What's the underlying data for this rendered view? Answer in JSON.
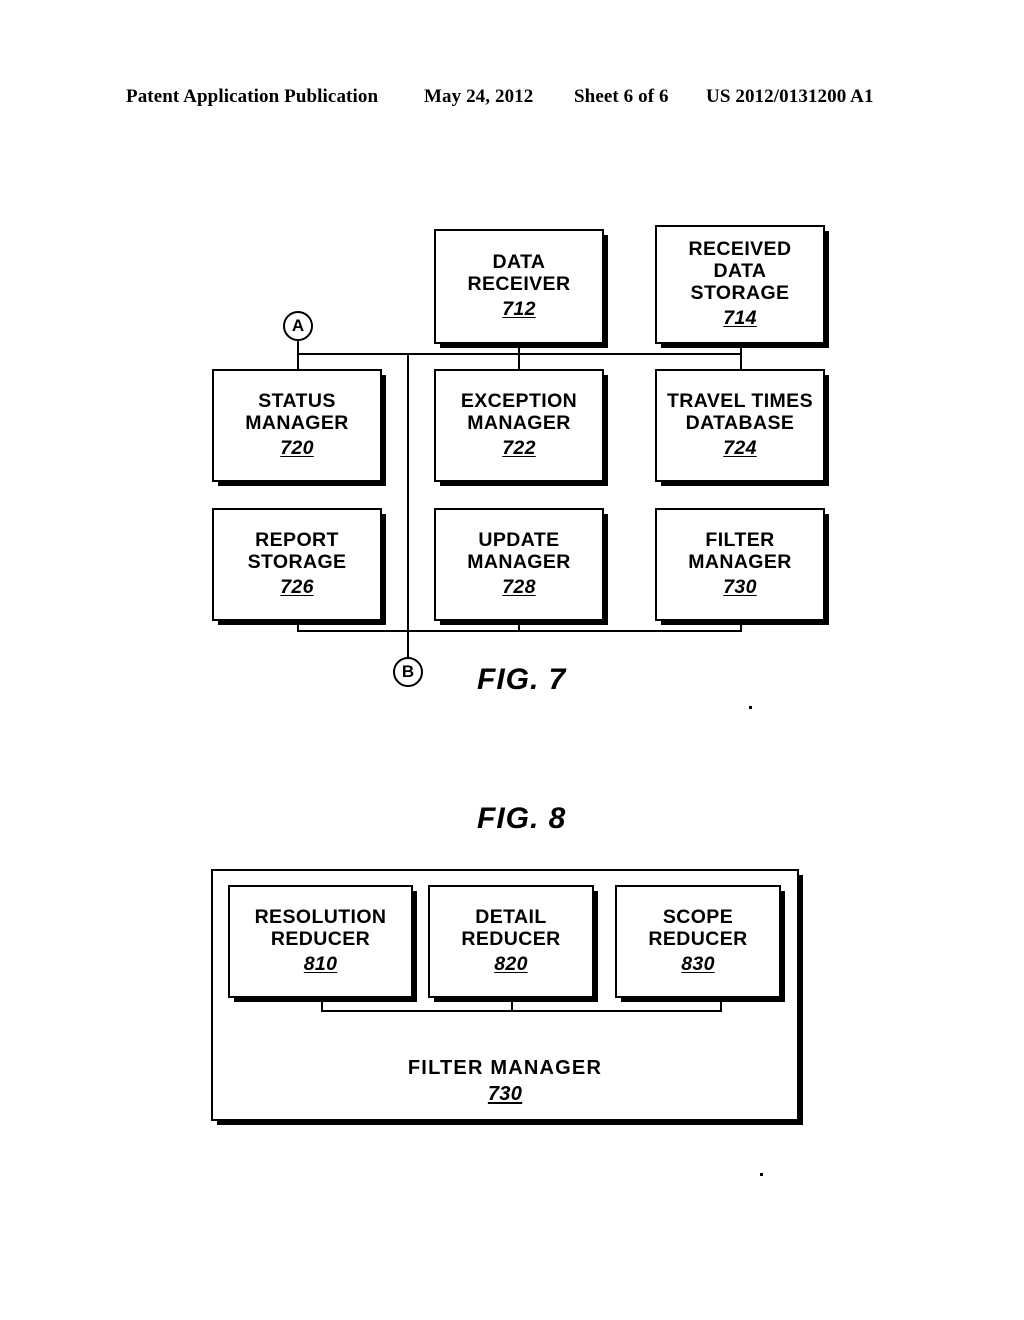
{
  "header": {
    "publication": "Patent Application Publication",
    "date": "May 24, 2012",
    "sheet": "Sheet 6 of 6",
    "patent_number": "US 2012/0131200 A1"
  },
  "figures": [
    {
      "caption": "FIG. 7",
      "connectors": [
        {
          "label": "A"
        },
        {
          "label": "B"
        }
      ],
      "boxes": [
        {
          "title": "DATA\nRECEIVER",
          "ref": "712"
        },
        {
          "title": "RECEIVED\nDATA\nSTORAGE",
          "ref": "714"
        },
        {
          "title": "STATUS\nMANAGER",
          "ref": "720"
        },
        {
          "title": "EXCEPTION\nMANAGER",
          "ref": "722"
        },
        {
          "title": "TRAVEL TIMES\nDATABASE",
          "ref": "724"
        },
        {
          "title": "REPORT\nSTORAGE",
          "ref": "726"
        },
        {
          "title": "UPDATE\nMANAGER",
          "ref": "728"
        },
        {
          "title": "FILTER\nMANAGER",
          "ref": "730"
        }
      ]
    },
    {
      "caption": "FIG. 8",
      "container": {
        "title": "FILTER MANAGER",
        "ref": "730"
      },
      "boxes": [
        {
          "title": "RESOLUTION\nREDUCER",
          "ref": "810"
        },
        {
          "title": "DETAIL\nREDUCER",
          "ref": "820"
        },
        {
          "title": "SCOPE\nREDUCER",
          "ref": "830"
        }
      ]
    }
  ],
  "colors": {
    "ink": "#000000",
    "paper": "#ffffff"
  }
}
